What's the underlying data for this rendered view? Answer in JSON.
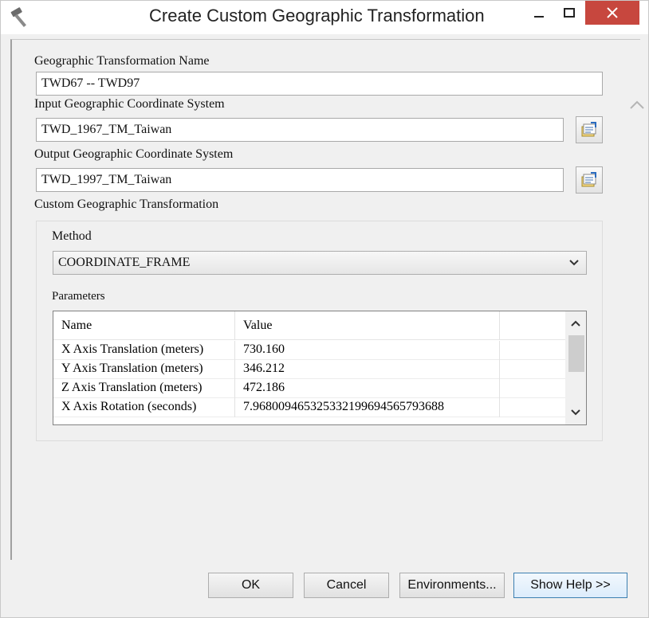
{
  "window": {
    "title": "Create Custom Geographic Transformation",
    "app_icon": "hammer-icon"
  },
  "transformation_name": {
    "label": "Geographic Transformation Name",
    "value": "TWD67 -- TWD97"
  },
  "input_gcs": {
    "label": "Input Geographic Coordinate System",
    "value": "TWD_1967_TM_Taiwan"
  },
  "output_gcs": {
    "label": "Output Geographic Coordinate System",
    "value": "TWD_1997_TM_Taiwan"
  },
  "custom": {
    "label": "Custom Geographic Transformation",
    "method_label": "Method",
    "method_value": "COORDINATE_FRAME",
    "parameters_label": "Parameters",
    "columns": [
      "Name",
      "Value"
    ],
    "rows": [
      {
        "name": "X Axis Translation (meters)",
        "value": "730.160"
      },
      {
        "name": "Y Axis Translation (meters)",
        "value": "346.212"
      },
      {
        "name": "Z Axis Translation (meters)",
        "value": "472.186"
      },
      {
        "name": "X Axis Rotation (seconds)",
        "value": "7.96800946532533219969456579368​8"
      }
    ]
  },
  "buttons": {
    "ok": "OK",
    "cancel": "Cancel",
    "environments": "Environments...",
    "help": "Show Help >>"
  },
  "colors": {
    "close_button": "#c7473e",
    "default_button_border": "#3c7fb1"
  }
}
